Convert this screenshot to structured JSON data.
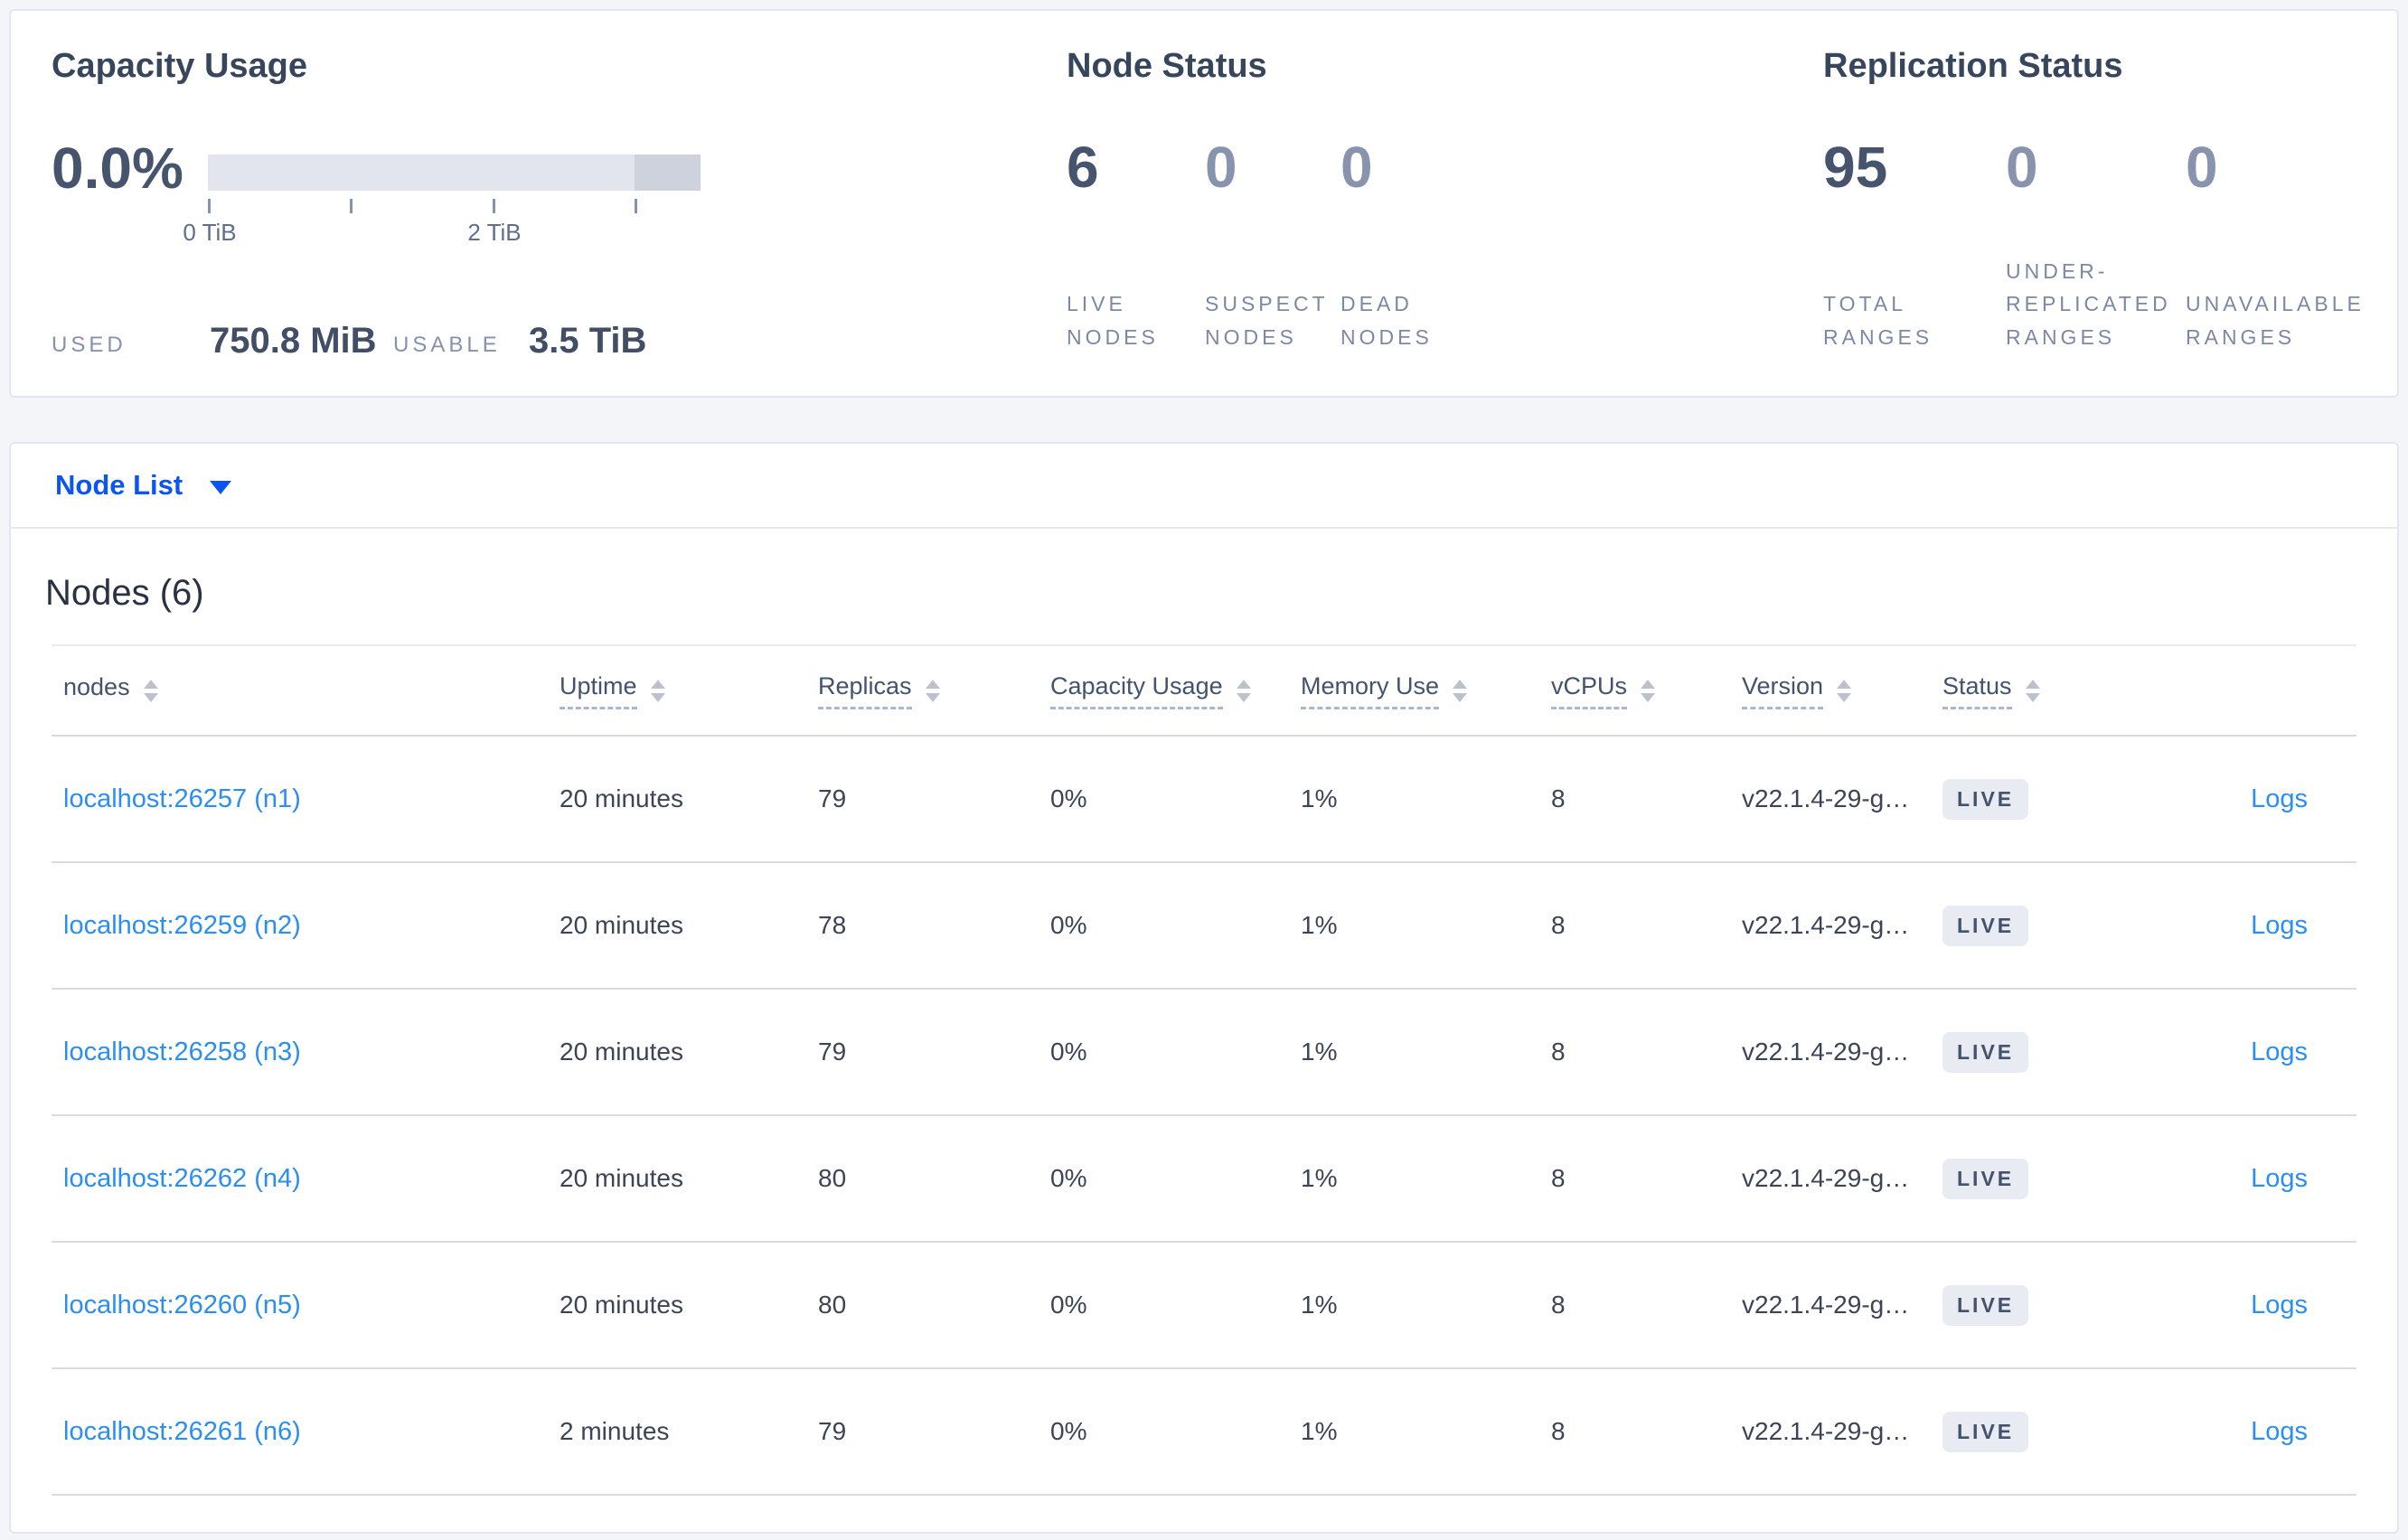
{
  "colors": {
    "accent_blue": "#0b55f0",
    "link_blue": "#2a8ef2",
    "badge_bg": "#e8ebf2",
    "badge_text": "#44526c",
    "value_dark": "#46546d",
    "value_dim": "#8893ae",
    "gauge_track": "#e2e4ee",
    "gauge_dark_segment": "#ced2dd"
  },
  "summary": {
    "capacity": {
      "title": "Capacity Usage",
      "percent": "0.0%",
      "tick_label_0": "0 TiB",
      "tick_label_2": "2 TiB",
      "used_label": "USED",
      "used_value": "750.8 MiB",
      "usable_label": "USABLE",
      "usable_value": "3.5 TiB"
    },
    "node_status": {
      "title": "Node Status",
      "metrics": [
        {
          "value": "6",
          "label": "LIVE NODES"
        },
        {
          "value": "0",
          "label": "SUSPECT NODES"
        },
        {
          "value": "0",
          "label": "DEAD NODES"
        }
      ]
    },
    "replication_status": {
      "title": "Replication Status",
      "metrics": [
        {
          "value": "95",
          "label": "TOTAL RANGES"
        },
        {
          "value": "0",
          "label": "UNDER-REPLICATED RANGES"
        },
        {
          "value": "0",
          "label": "UNAVAILABLE RANGES"
        }
      ]
    }
  },
  "view_selector": {
    "label": "Node List",
    "caret_icon": "caret-down"
  },
  "nodes_table": {
    "title": "Nodes (6)",
    "columns": {
      "nodes": "nodes",
      "uptime": "Uptime",
      "replicas": "Replicas",
      "capacity": "Capacity Usage",
      "memory": "Memory Use",
      "vcpus": "vCPUs",
      "version": "Version",
      "status": "Status"
    },
    "sort_icon": "sort-arrows",
    "rows": [
      {
        "node": "localhost:26257 (n1)",
        "uptime": "20 minutes",
        "replicas": "79",
        "capacity": "0%",
        "memory": "1%",
        "vcpus": "8",
        "version": "v22.1.4-29-g…",
        "status": "LIVE",
        "logs": "Logs"
      },
      {
        "node": "localhost:26259 (n2)",
        "uptime": "20 minutes",
        "replicas": "78",
        "capacity": "0%",
        "memory": "1%",
        "vcpus": "8",
        "version": "v22.1.4-29-g…",
        "status": "LIVE",
        "logs": "Logs"
      },
      {
        "node": "localhost:26258 (n3)",
        "uptime": "20 minutes",
        "replicas": "79",
        "capacity": "0%",
        "memory": "1%",
        "vcpus": "8",
        "version": "v22.1.4-29-g…",
        "status": "LIVE",
        "logs": "Logs"
      },
      {
        "node": "localhost:26262 (n4)",
        "uptime": "20 minutes",
        "replicas": "80",
        "capacity": "0%",
        "memory": "1%",
        "vcpus": "8",
        "version": "v22.1.4-29-g…",
        "status": "LIVE",
        "logs": "Logs"
      },
      {
        "node": "localhost:26260 (n5)",
        "uptime": "20 minutes",
        "replicas": "80",
        "capacity": "0%",
        "memory": "1%",
        "vcpus": "8",
        "version": "v22.1.4-29-g…",
        "status": "LIVE",
        "logs": "Logs"
      },
      {
        "node": "localhost:26261 (n6)",
        "uptime": "2 minutes",
        "replicas": "79",
        "capacity": "0%",
        "memory": "1%",
        "vcpus": "8",
        "version": "v22.1.4-29-g…",
        "status": "LIVE",
        "logs": "Logs"
      }
    ]
  }
}
